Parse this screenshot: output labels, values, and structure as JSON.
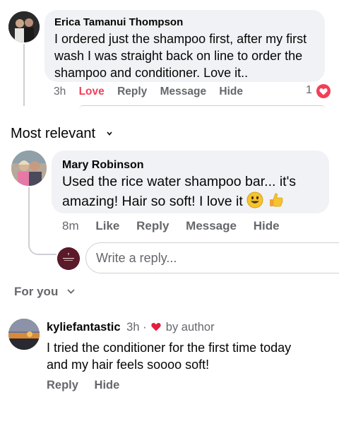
{
  "comment1": {
    "author": "Erica Tamanui Thompson",
    "text_line1": "I ordered just the shampoo first, after my first",
    "text_line2": "wash I was straight back on line to order the",
    "text_line3": "shampoo and conditioner.  Love it..",
    "time": "3h",
    "love_label": "Love",
    "reply_label": "Reply",
    "message_label": "Message",
    "hide_label": "Hide",
    "reaction_count": "1"
  },
  "most_relevant": {
    "label": "Most relevant"
  },
  "comment2": {
    "author": "Mary Robinson",
    "text_line1": "Used the rice water shampoo bar... it's",
    "text_line2": "amazing! Hair so soft! I love it",
    "time": "8m",
    "like_label": "Like",
    "reply_label": "Reply",
    "message_label": "Message",
    "hide_label": "Hide"
  },
  "reply_input": {
    "placeholder": "Write a reply..."
  },
  "for_you": {
    "label": "For you"
  },
  "comment3": {
    "author": "kyliefantastic",
    "time": "3h ·",
    "badge": "by author",
    "text_line1": "I tried the conditioner for the first time today",
    "text_line2": "and my hair feels soooo soft!",
    "reply_label": "Reply",
    "hide_label": "Hide"
  },
  "colors": {
    "bubble": "#f0f2f5",
    "love": "#f33e58",
    "meta": "#65676b",
    "heart": "#e41e3f"
  }
}
